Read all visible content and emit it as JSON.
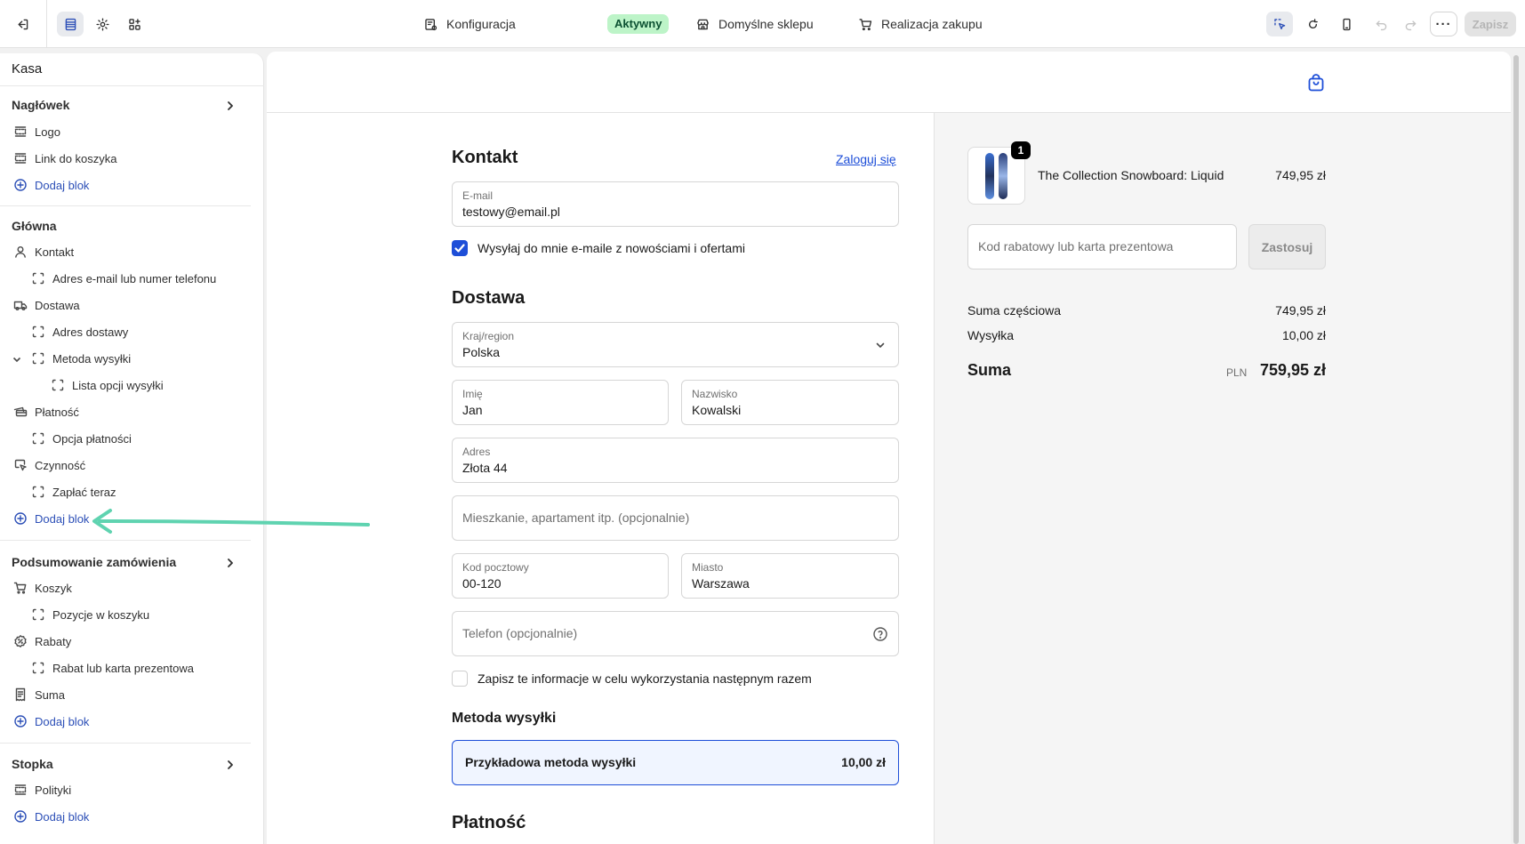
{
  "toolbar": {
    "exit_icon": "exit-icon",
    "sections_icon": "sections-icon",
    "settings_icon": "gear-icon",
    "apps_icon": "apps-icon",
    "config_label": "Konfiguracja",
    "status_badge": "Aktywny",
    "store_label": "Domyślne sklepu",
    "checkout_label": "Realizacja zakupu",
    "more_label": "···",
    "save_label": "Zapisz"
  },
  "sidebar": {
    "title": "Kasa",
    "header_section": {
      "title": "Nagłówek",
      "items": [
        "Logo",
        "Link do koszyka"
      ],
      "add_label": "Dodaj blok"
    },
    "main_section": {
      "title": "Główna",
      "items": [
        {
          "label": "Kontakt",
          "level": 0
        },
        {
          "label": "Adres e-mail lub numer telefonu",
          "level": 1
        },
        {
          "label": "Dostawa",
          "level": 0
        },
        {
          "label": "Adres dostawy",
          "level": 1
        },
        {
          "label": "Metoda wysyłki",
          "level": 1
        },
        {
          "label": "Lista opcji wysyłki",
          "level": 2
        },
        {
          "label": "Płatność",
          "level": 0
        },
        {
          "label": "Opcja płatności",
          "level": 1
        },
        {
          "label": "Czynność",
          "level": 0
        },
        {
          "label": "Zapłać teraz",
          "level": 1
        }
      ],
      "add_label": "Dodaj blok"
    },
    "summary_section": {
      "title": "Podsumowanie zamówienia",
      "items": [
        {
          "label": "Koszyk",
          "level": 0
        },
        {
          "label": "Pozycje w koszyku",
          "level": 1
        },
        {
          "label": "Rabaty",
          "level": 0
        },
        {
          "label": "Rabat lub karta prezentowa",
          "level": 1
        },
        {
          "label": "Suma",
          "level": 0
        }
      ],
      "add_label": "Dodaj blok"
    },
    "footer_section": {
      "title": "Stopka",
      "items": [
        "Polityki"
      ],
      "add_label": "Dodaj blok"
    }
  },
  "checkout": {
    "contact": {
      "title": "Kontakt",
      "login_link": "Zaloguj się",
      "email_label": "E-mail",
      "email_value": "testowy@email.pl",
      "newsletter_label": "Wysyłaj do mnie e-maile z nowościami i ofertami",
      "newsletter_checked": true
    },
    "delivery": {
      "title": "Dostawa",
      "country_label": "Kraj/region",
      "country_value": "Polska",
      "first_name_label": "Imię",
      "first_name_value": "Jan",
      "last_name_label": "Nazwisko",
      "last_name_value": "Kowalski",
      "address_label": "Adres",
      "address_value": "Złota 44",
      "apartment_placeholder": "Mieszkanie, apartament itp. (opcjonalnie)",
      "postal_label": "Kod pocztowy",
      "postal_value": "00-120",
      "city_label": "Miasto",
      "city_value": "Warszawa",
      "phone_placeholder": "Telefon (opcjonalnie)",
      "save_info_label": "Zapisz te informacje w celu wykorzystania następnym razem",
      "save_info_checked": false
    },
    "shipping": {
      "title": "Metoda wysyłki",
      "option_name": "Przykładowa metoda wysyłki",
      "option_price": "10,00 zł"
    },
    "payment": {
      "title": "Płatność"
    }
  },
  "summary": {
    "product_name": "The Collection Snowboard: Liquid",
    "product_price": "749,95 zł",
    "quantity": "1",
    "discount_placeholder": "Kod rabatowy lub karta prezentowa",
    "apply_label": "Zastosuj",
    "subtotal_label": "Suma częściowa",
    "subtotal_value": "749,95 zł",
    "shipping_label": "Wysyłka",
    "shipping_value": "10,00 zł",
    "total_label": "Suma",
    "currency": "PLN",
    "total_value": "759,95 zł"
  },
  "colors": {
    "accent": "#1d4ed8",
    "badge_bg": "#bdf4c8",
    "annotation_arrow": "#5fd3b0"
  }
}
